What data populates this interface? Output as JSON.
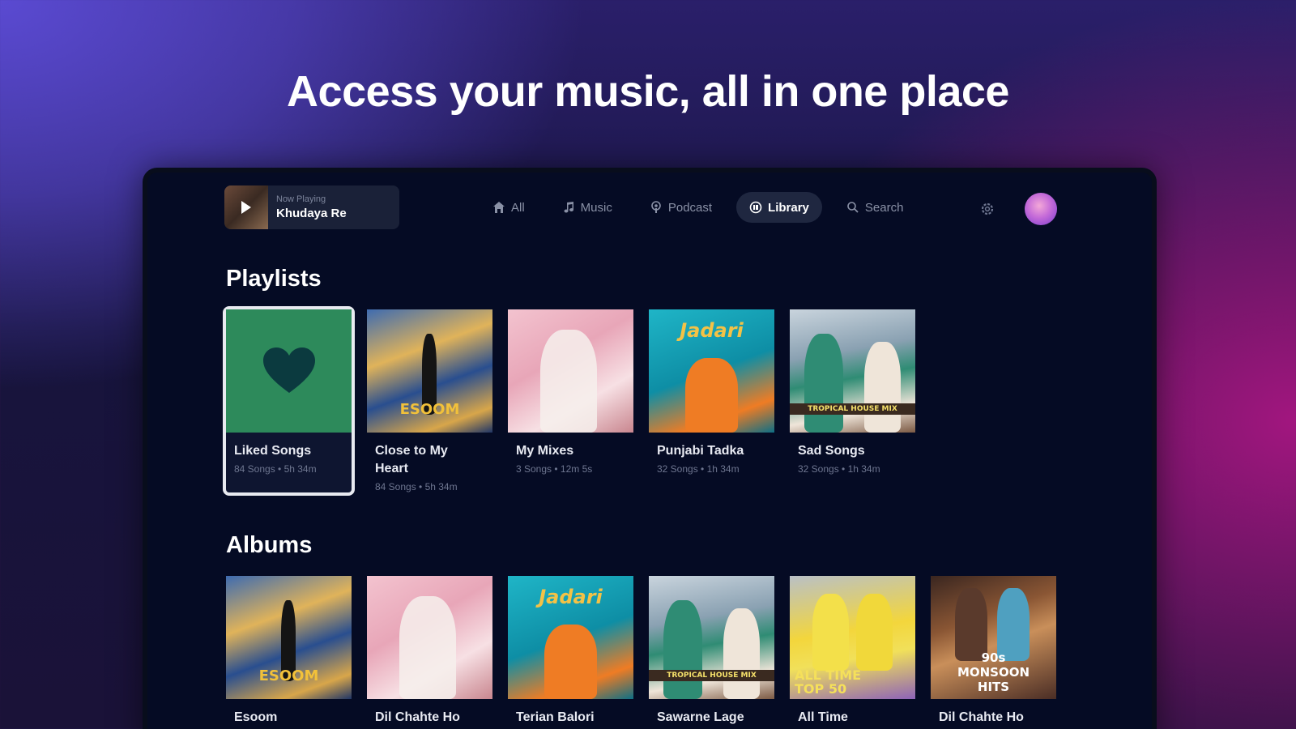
{
  "headline": "Access your music, all in one place",
  "now_playing": {
    "label": "Now Playing",
    "title": "Khudaya Re"
  },
  "nav": {
    "items": [
      {
        "label": "All",
        "icon": "home-icon"
      },
      {
        "label": "Music",
        "icon": "music-note-icon"
      },
      {
        "label": "Podcast",
        "icon": "podcast-icon"
      },
      {
        "label": "Library",
        "icon": "library-icon",
        "active": true
      },
      {
        "label": "Search",
        "icon": "search-icon"
      }
    ]
  },
  "playlists": {
    "title": "Playlists",
    "items": [
      {
        "title": "Liked Songs",
        "subtitle": "84 Songs • 5h 34m"
      },
      {
        "title": "Close to My Heart",
        "subtitle": "84 Songs • 5h 34m",
        "art_text": "ESOOM"
      },
      {
        "title": "My Mixes",
        "subtitle": "3 Songs • 12m 5s"
      },
      {
        "title": "Punjabi Tadka",
        "subtitle": "32 Songs • 1h 34m",
        "art_text": "Jadari"
      },
      {
        "title": "Sad Songs",
        "subtitle": "32 Songs • 1h 34m",
        "art_text": "TROPICAL HOUSE MIX"
      }
    ]
  },
  "albums": {
    "title": "Albums",
    "items": [
      {
        "title": "Esoom",
        "art_text": "ESOOM"
      },
      {
        "title": "Dil Chahte Ho"
      },
      {
        "title": "Terian Balori",
        "art_text": "Jadari"
      },
      {
        "title": "Sawarne Lage",
        "art_text": "TROPICAL HOUSE MIX"
      },
      {
        "title": "All Time",
        "art_text": "ALL TIME TOP 50"
      },
      {
        "title": "Dil Chahte Ho",
        "art_text": "90s MONSOON HITS"
      }
    ]
  },
  "colors": {
    "liked_green": "#2d8a5b",
    "screen_bg": "#050b24",
    "active_pill": "#1f2740"
  }
}
